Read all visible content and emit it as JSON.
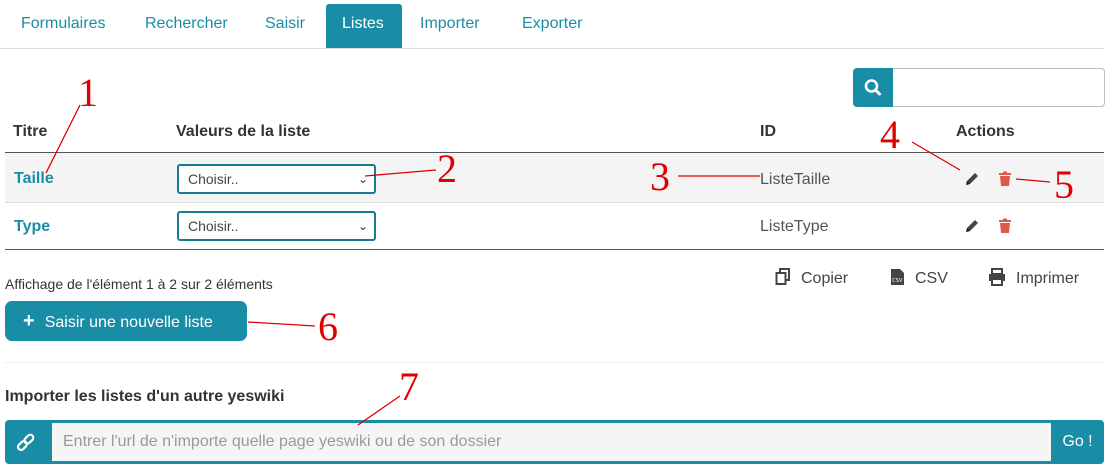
{
  "tabs": [
    {
      "label": "Formulaires"
    },
    {
      "label": "Rechercher"
    },
    {
      "label": "Saisir"
    },
    {
      "label": "Listes",
      "active": true
    },
    {
      "label": "Importer"
    },
    {
      "label": "Exporter"
    }
  ],
  "search": {
    "placeholder": "",
    "icon": "search-icon"
  },
  "table": {
    "headers": {
      "title": "Titre",
      "values": "Valeurs de la liste",
      "id": "ID",
      "actions": "Actions"
    },
    "rows": [
      {
        "title": "Taille",
        "select": "Choisir..",
        "id": "ListeTaille"
      },
      {
        "title": "Type",
        "select": "Choisir..",
        "id": "ListeType"
      }
    ]
  },
  "info": "Affichage de l'élément 1 à 2 sur 2 éléments",
  "export": {
    "copy": "Copier",
    "csv": "CSV",
    "print": "Imprimer"
  },
  "new_list_button": "Saisir une nouvelle liste",
  "import": {
    "label": "Importer les listes d'un autre yeswiki",
    "placeholder": "Entrer l'url de n'importe quelle page yeswiki ou de son dossier",
    "go": "Go !"
  },
  "annotations": [
    "1",
    "2",
    "3",
    "4",
    "5",
    "6",
    "7"
  ],
  "colors": {
    "accent": "#1a8da6",
    "delete": "#e05a47",
    "annotation": "#e00000"
  }
}
